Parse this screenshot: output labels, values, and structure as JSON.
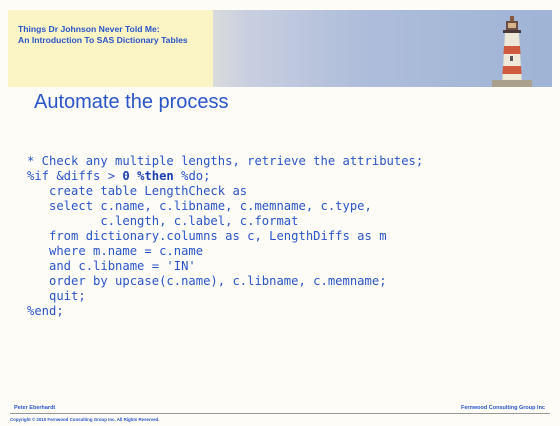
{
  "header": {
    "title_line1": "Things Dr Johnson Never Told Me:",
    "title_line2": "An Introduction To SAS Dictionary Tables"
  },
  "slide": {
    "heading": "Automate the process"
  },
  "code_lines": [
    {
      "text": "* Check any multiple lengths, retrieve the attributes;"
    },
    {
      "pre": "%if &diffs > ",
      "kw": "0 %then",
      "post": " %do;"
    },
    {
      "text": "   create table LengthCheck as"
    },
    {
      "text": "   select c.name, c.libname, c.memname, c.type,"
    },
    {
      "text": "          c.length, c.label, c.format"
    },
    {
      "text": "   from dictionary.columns as c, LengthDiffs as m"
    },
    {
      "text": "   where m.name = c.name"
    },
    {
      "text": "   and c.libname = 'IN'"
    },
    {
      "text": "   order by upcase(c.name), c.libname, c.memname;"
    },
    {
      "text": "   quit;"
    },
    {
      "text": "%end;"
    }
  ],
  "footer": {
    "author": "Peter Eberhardt",
    "company": "Fernwood Consulting Group Inc",
    "copyright": "Copyright © 2010 Fernwood Consulting Group Inc. All Rights Reserved."
  },
  "colors": {
    "accent": "#2a55c8",
    "banner_cream": "#fbf5c6",
    "banner_blue": "#9fb4d6"
  },
  "icons": {
    "banner_image": "lighthouse-icon"
  }
}
